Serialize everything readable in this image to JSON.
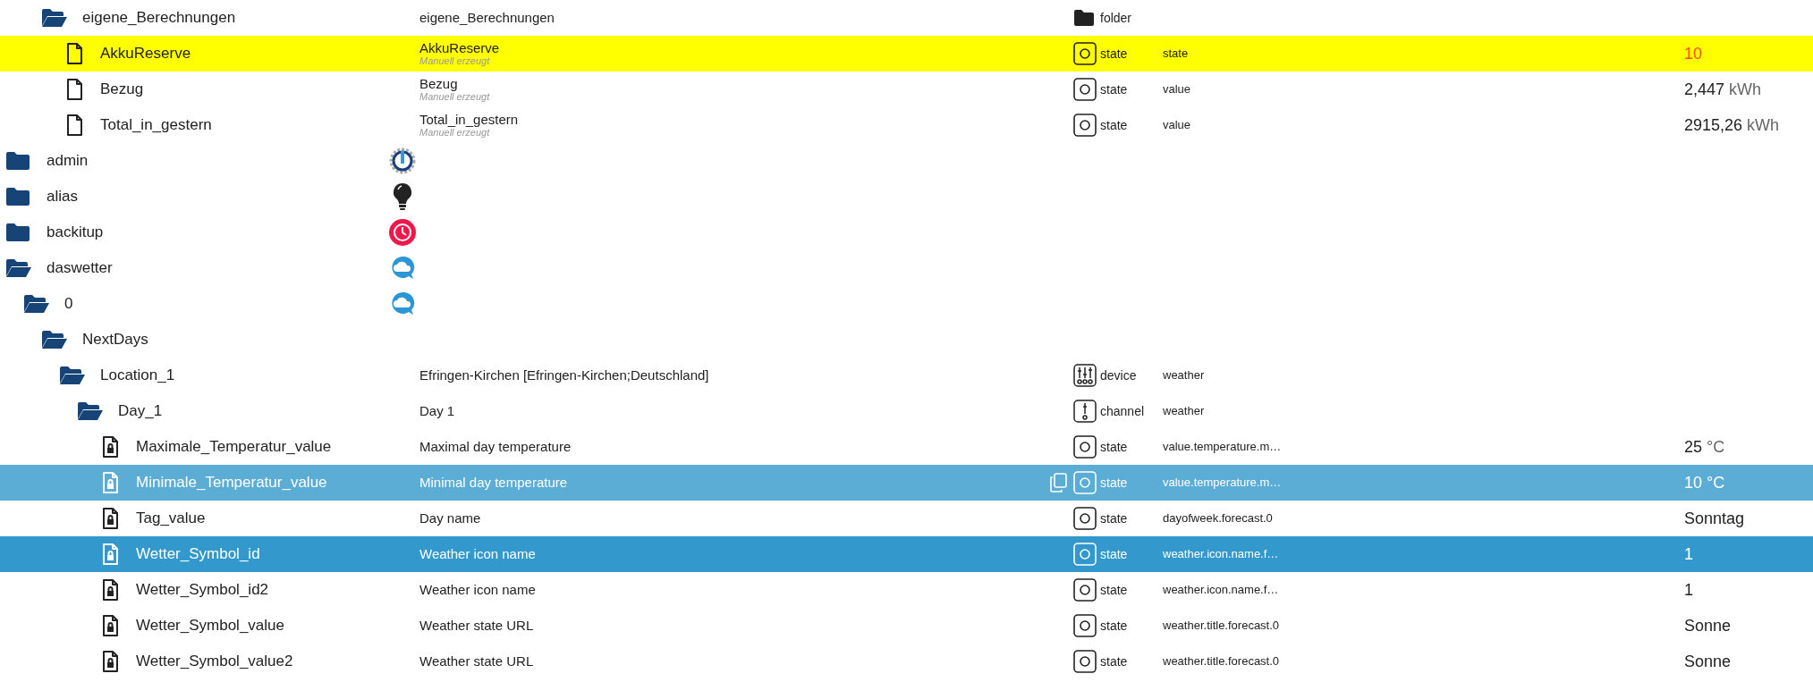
{
  "tree": [
    {
      "children": [
        {
          "children": [
            {
              "name": "eigene_Berechnungen",
              "kind": "folder",
              "expanded": true,
              "selected": false,
              "hovered": false,
              "description": "eigene_Berechnungen",
              "type_icon": {
                "kind": "folder"
              },
              "object_type": "folder",
              "children": [
                {
                  "name": "AkkuReserve",
                  "kind": "file",
                  "selected": false,
                  "hovered": false,
                  "color": "#ffff00",
                  "description": "AkkuReserve",
                  "note": "Manuell erzeugt",
                  "type_icon": {
                    "kind": "state"
                  },
                  "object_type": "state",
                  "role": "state",
                  "value": "10",
                  "value_style": {
                    "color": "#ff4d1a"
                  }
                },
                {
                  "name": "Bezug",
                  "kind": "file",
                  "selected": false,
                  "hovered": false,
                  "description": "Bezug",
                  "note": "Manuell erzeugt",
                  "type_icon": {
                    "kind": "state"
                  },
                  "object_type": "state",
                  "role": "value",
                  "value": "2,447",
                  "unit": "kWh"
                },
                {
                  "name": "Total_in_gestern",
                  "kind": "file",
                  "selected": false,
                  "hovered": false,
                  "description": "Total_in_gestern",
                  "note": "Manuell erzeugt",
                  "type_icon": {
                    "kind": "state"
                  },
                  "object_type": "state",
                  "role": "value",
                  "value": "2915,26",
                  "unit": "kWh"
                }
              ]
            }
          ]
        }
      ]
    },
    {
      "name": "admin",
      "kind": "folder",
      "expanded": false,
      "selected": false,
      "hovered": false,
      "logo": {
        "kind": "gear"
      }
    },
    {
      "name": "alias",
      "kind": "folder",
      "expanded": false,
      "selected": false,
      "hovered": false,
      "logo": {
        "kind": "bulb"
      }
    },
    {
      "name": "backitup",
      "kind": "folder",
      "expanded": false,
      "selected": false,
      "hovered": false,
      "logo": {
        "kind": "clock"
      }
    },
    {
      "name": "daswetter",
      "kind": "folder",
      "expanded": true,
      "selected": false,
      "hovered": false,
      "logo": {
        "kind": "cloud"
      },
      "children": [
        {
          "name": "0",
          "kind": "folder",
          "expanded": true,
          "selected": false,
          "hovered": false,
          "logo": {
            "kind": "cloud"
          },
          "children": [
            {
              "name": "NextDays",
              "kind": "folder",
              "expanded": true,
              "selected": false,
              "hovered": false,
              "children": [
                {
                  "name": "Location_1",
                  "kind": "folder",
                  "expanded": true,
                  "selected": false,
                  "hovered": false,
                  "description": "Efringen-Kirchen [Efringen-Kirchen;Deutschland]",
                  "type_icon": {
                    "kind": "device"
                  },
                  "object_type": "device",
                  "role": "weather",
                  "children": [
                    {
                      "name": "Day_1",
                      "kind": "folder",
                      "expanded": true,
                      "selected": false,
                      "hovered": false,
                      "description": "Day 1",
                      "type_icon": {
                        "kind": "channel"
                      },
                      "object_type": "channel",
                      "role": "weather",
                      "children": [
                        {
                          "name": "Maximale_Temperatur_value",
                          "kind": "locked_file",
                          "selected": false,
                          "hovered": false,
                          "description": "Maximal day temperature",
                          "type_icon": {
                            "kind": "state"
                          },
                          "object_type": "state",
                          "role": "value.temperature.m…",
                          "value": "25",
                          "unit": "°C"
                        },
                        {
                          "name": "Minimale_Temperatur_value",
                          "kind": "locked_file",
                          "selected": false,
                          "hovered": true,
                          "description": "Minimal day temperature",
                          "type_icon": {
                            "kind": "state"
                          },
                          "object_type": "state",
                          "role": "value.temperature.m…",
                          "value": "10",
                          "unit": "°C"
                        },
                        {
                          "name": "Tag_value",
                          "kind": "locked_file",
                          "selected": false,
                          "hovered": false,
                          "description": "Day name",
                          "type_icon": {
                            "kind": "state"
                          },
                          "object_type": "state",
                          "role": "dayofweek.forecast.0",
                          "value": "Sonntag"
                        },
                        {
                          "name": "Wetter_Symbol_id",
                          "kind": "locked_file",
                          "selected": true,
                          "hovered": false,
                          "description": "Weather icon name",
                          "type_icon": {
                            "kind": "state"
                          },
                          "object_type": "state",
                          "role": "weather.icon.name.f…",
                          "value": "1"
                        },
                        {
                          "name": "Wetter_Symbol_id2",
                          "kind": "locked_file",
                          "selected": false,
                          "hovered": false,
                          "description": "Weather icon name",
                          "type_icon": {
                            "kind": "state"
                          },
                          "object_type": "state",
                          "role": "weather.icon.name.f…",
                          "value": "1"
                        },
                        {
                          "name": "Wetter_Symbol_value",
                          "kind": "locked_file",
                          "selected": false,
                          "hovered": false,
                          "description": "Weather state URL",
                          "type_icon": {
                            "kind": "state"
                          },
                          "object_type": "state",
                          "role": "weather.title.forecast.0",
                          "value": "Sonne"
                        },
                        {
                          "name": "Wetter_Symbol_value2",
                          "kind": "locked_file",
                          "selected": false,
                          "hovered": false,
                          "description": "Weather state URL",
                          "type_icon": {
                            "kind": "state"
                          },
                          "object_type": "state",
                          "role": "weather.title.forecast.0",
                          "value": "Sonne"
                        }
                      ]
                    }
                  ]
                }
              ]
            }
          ]
        }
      ]
    }
  ]
}
